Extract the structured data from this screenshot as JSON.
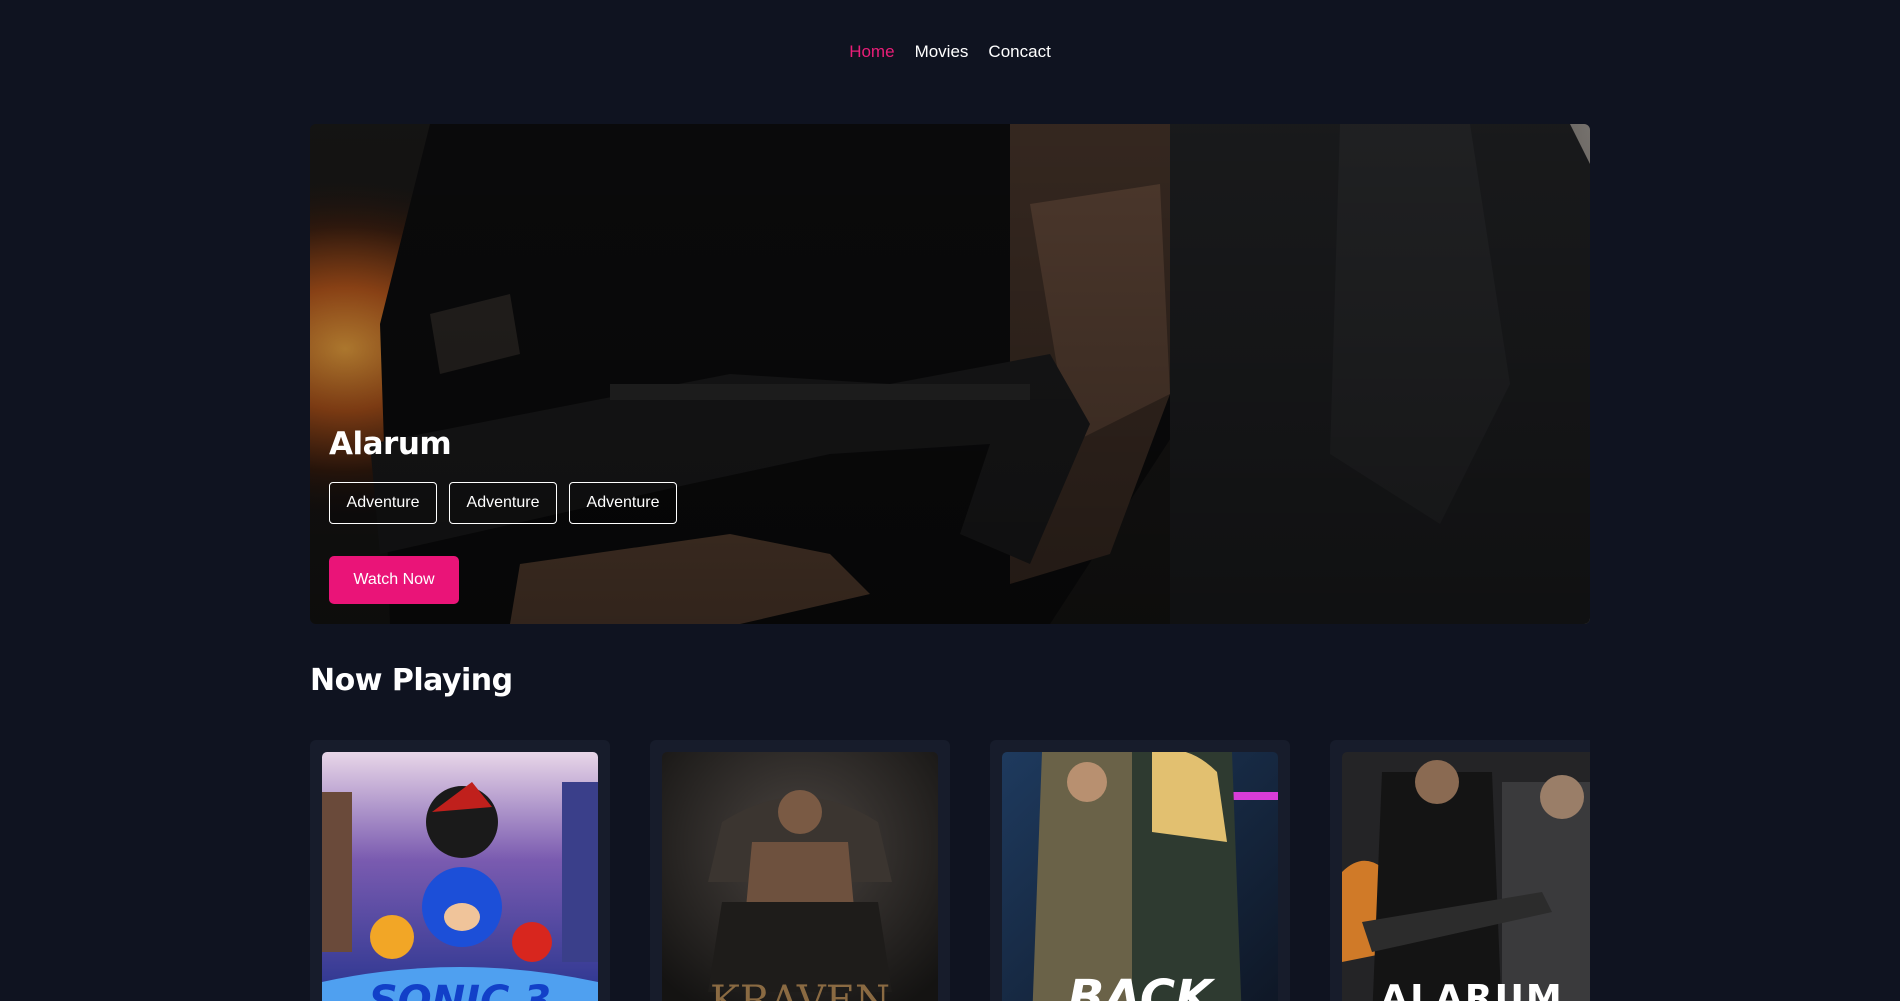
{
  "nav": {
    "items": [
      {
        "label": "Home",
        "active": true
      },
      {
        "label": "Movies",
        "active": false
      },
      {
        "label": "Concact",
        "active": false
      }
    ]
  },
  "hero": {
    "title": "Alarum",
    "genres": [
      "Adventure",
      "Adventure",
      "Adventure"
    ],
    "cta_label": "Watch Now"
  },
  "now_playing": {
    "title": "Now Playing",
    "movies": [
      {
        "poster_text": "SONIC 3",
        "icon": "sonic-poster"
      },
      {
        "poster_text": "KRAVEN",
        "icon": "kraven-poster"
      },
      {
        "poster_text": "BACK",
        "icon": "back-in-action-poster"
      },
      {
        "poster_text": "ALARUM",
        "icon": "alarum-poster"
      }
    ]
  },
  "colors": {
    "background": "#0f1320",
    "accent": "#ea1478",
    "card": "#171c2b"
  }
}
